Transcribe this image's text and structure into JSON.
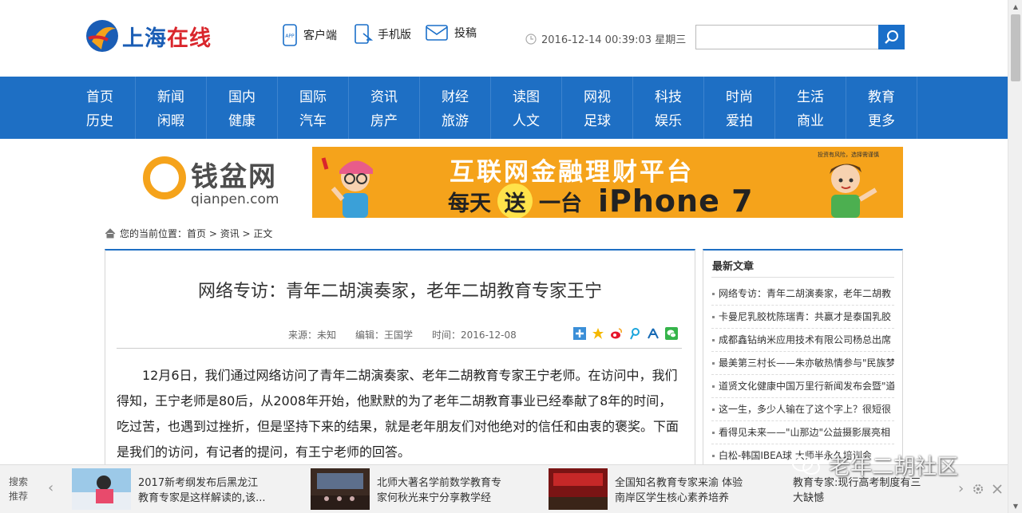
{
  "header": {
    "logo_text_a": "上海",
    "logo_text_b": "在线",
    "links": [
      {
        "label": "客户端",
        "icon": "app-phone-icon"
      },
      {
        "label": "手机版",
        "icon": "mobile-icon"
      },
      {
        "label": "投稿",
        "icon": "envelope-icon"
      }
    ],
    "datetime": "2016-12-14 00:39:03 星期三",
    "search_placeholder": ""
  },
  "nav": [
    [
      "首页",
      "历史"
    ],
    [
      "新闻",
      "闲暇"
    ],
    [
      "国内",
      "健康"
    ],
    [
      "国际",
      "汽车"
    ],
    [
      "资讯",
      "房产"
    ],
    [
      "财经",
      "旅游"
    ],
    [
      "读图",
      "人文"
    ],
    [
      "网视",
      "足球"
    ],
    [
      "科技",
      "娱乐"
    ],
    [
      "时尚",
      "爱拍"
    ],
    [
      "生活",
      "商业"
    ],
    [
      "教育",
      "更多"
    ]
  ],
  "banner": {
    "brand": "钱盆网",
    "brand_url": "qianpen.com",
    "headline": "互联网金融理财平台",
    "line_a": "每天",
    "line_circle": "送",
    "line_b": "一台",
    "line_product": "iPhone 7",
    "note": "投资有风险，选择需谨慎"
  },
  "breadcrumb": {
    "prefix": "您的当前位置：",
    "home": "首页",
    "sep": " > ",
    "section": "资讯",
    "current": "正文"
  },
  "article": {
    "title": "网络专访：青年二胡演奏家，老年二胡教育专家王宁",
    "source": "来源：未知",
    "editor": "编辑：王国学",
    "time": "时间：2016-12-08",
    "body": "12月6日，我们通过网络访问了青年二胡演奏家、老年二胡教育专家王宁老师。在访问中，我们得知，王宁老师是80后，从2008年开始，他默默的为了老年二胡教育事业已经奉献了8年的时间，吃过苦，也遇到过挫折，但是坚持下来的结果，就是老年朋友们对他绝对的信任和由衷的褒奖。下面是我们的访问，有记者的提问，有王宁老师的回答。"
  },
  "sidebar": {
    "heading": "最新文章",
    "items": [
      "网络专访：青年二胡演奏家，老年二胡教",
      "卡曼尼乳胶枕陈瑞青：共赢才是泰国乳胶",
      "成都鑫钻纳米应用技术有限公司杨总出席",
      "最美第三村长——朱亦敏热情参与\"民族梦",
      "道贤文化健康中国万里行新闻发布会暨\"道",
      "这一生，多少人输在了这个字上？很短很",
      "看得见未来——\"山那边\"公益摄影展亮相",
      "白松-韩国IBEA球 大师半永久培训会"
    ]
  },
  "recommend": {
    "label_1": "搜索",
    "label_2": "推荐",
    "prev": "‹",
    "next": "›",
    "items": [
      {
        "line1": "2017新考纲发布后黑龙江",
        "line2": "教育专家是这样解读的,该..."
      },
      {
        "line1": "北师大著名学前数学教育专",
        "line2": "家何秋光来宁分享教学经"
      },
      {
        "line1": "全国知名教育专家来渝 体验",
        "line2": "南岸区学生核心素养培养"
      },
      {
        "line1": "教育专家:现行高考制度有三",
        "line2": "大缺憾"
      }
    ]
  },
  "watermark": "老年二胡社区",
  "colors": {
    "nav_bg": "#1e6fc4",
    "banner_bg": "#f5a31b",
    "logo_blue": "#1a5db5",
    "logo_red": "#d9262c"
  }
}
